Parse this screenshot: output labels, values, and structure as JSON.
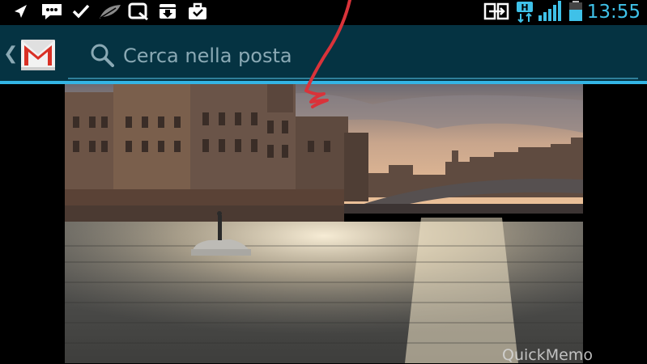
{
  "status_bar": {
    "time": "13:55",
    "network_type": "H",
    "icons": [
      "navigation-icon",
      "chat-icon",
      "check-icon",
      "feather-icon",
      "message-icon",
      "download-icon",
      "briefcase-icon",
      "screen-mirror-icon",
      "network-h-icon",
      "signal-icon",
      "battery-icon"
    ],
    "accent_color": "#3fc1e8"
  },
  "action_bar": {
    "back_icon": "chevron-left-icon",
    "logo": "gmail-logo",
    "search_placeholder": "Cerca nella posta",
    "background": "#053342",
    "accent_line": "#33b5e5"
  },
  "content": {
    "image": "river-photo",
    "annotation": "red-pen-stroke",
    "watermark": "QuickMemo"
  }
}
